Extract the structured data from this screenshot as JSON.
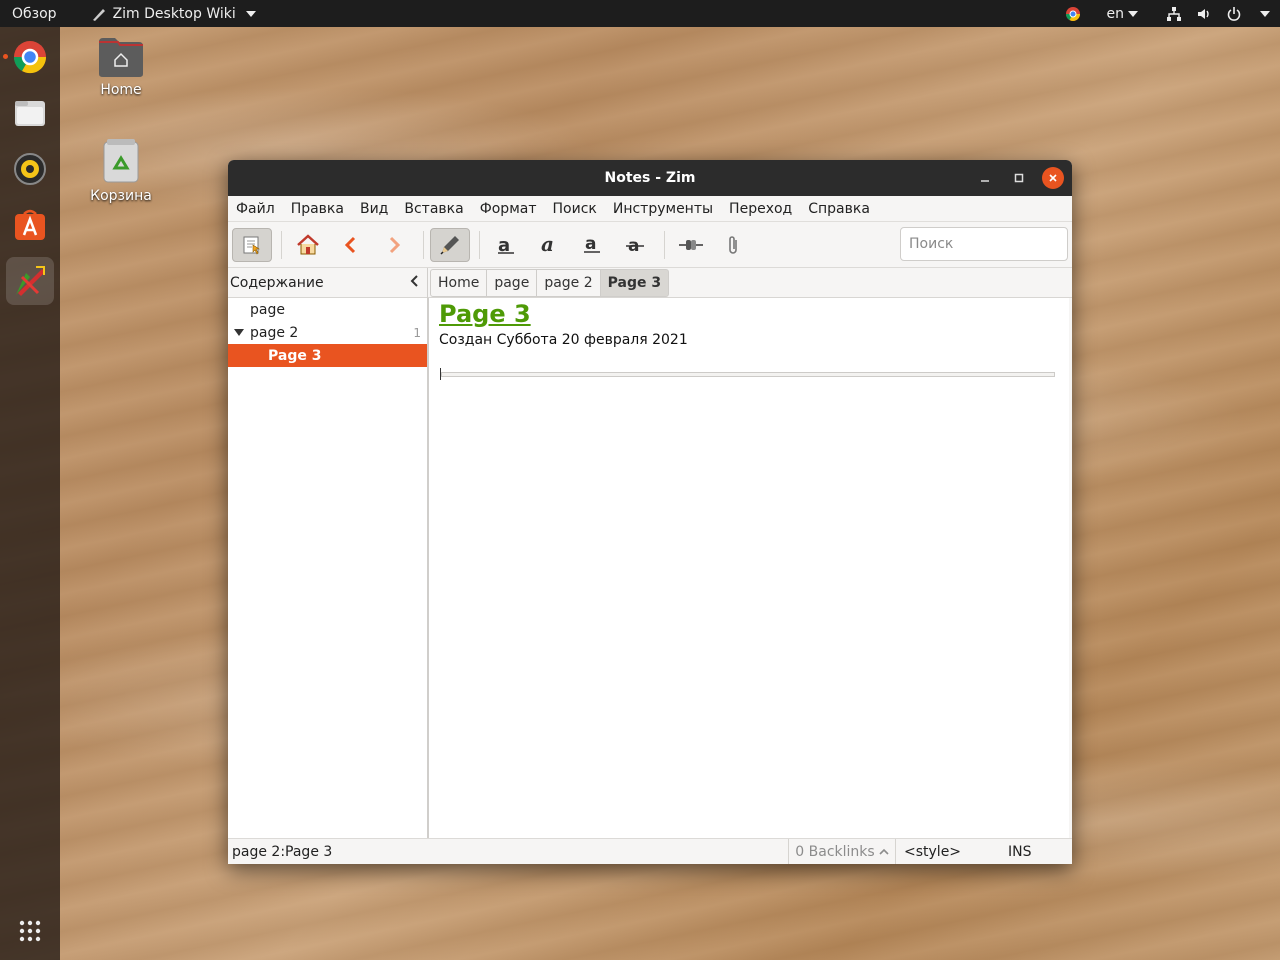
{
  "topbar": {
    "activities": "Обзор",
    "app_name": "Zim Desktop Wiki",
    "lang": "en"
  },
  "dock": {
    "items": [
      "chrome-icon",
      "files-icon",
      "rhythmbox-icon",
      "software-icon",
      "zim-icon"
    ],
    "apps_grid": "show-applications-icon"
  },
  "desktop": {
    "home_label": "Home",
    "trash_label": "Корзина"
  },
  "window": {
    "title": "Notes - Zim",
    "menu": [
      "Файл",
      "Правка",
      "Вид",
      "Вставка",
      "Формат",
      "Поиск",
      "Инструменты",
      "Переход",
      "Справка"
    ],
    "search_placeholder": "Поиск",
    "sidepane": {
      "header": "Содержание",
      "items": [
        {
          "label": "page"
        },
        {
          "label": "page 2",
          "count": "1"
        },
        {
          "label": "Page 3"
        }
      ]
    },
    "pathbar": [
      "Home",
      "page",
      "page 2",
      "Page 3"
    ],
    "page": {
      "title": "Page 3",
      "created": "Создан Суббота 20 февраля 2021"
    },
    "status": {
      "path": "page 2:Page 3",
      "backlinks": "0 Backlinks",
      "style": "<style>",
      "mode": "INS"
    }
  },
  "colors": {
    "accent": "#e95420",
    "title_green": "#4e9a06"
  }
}
